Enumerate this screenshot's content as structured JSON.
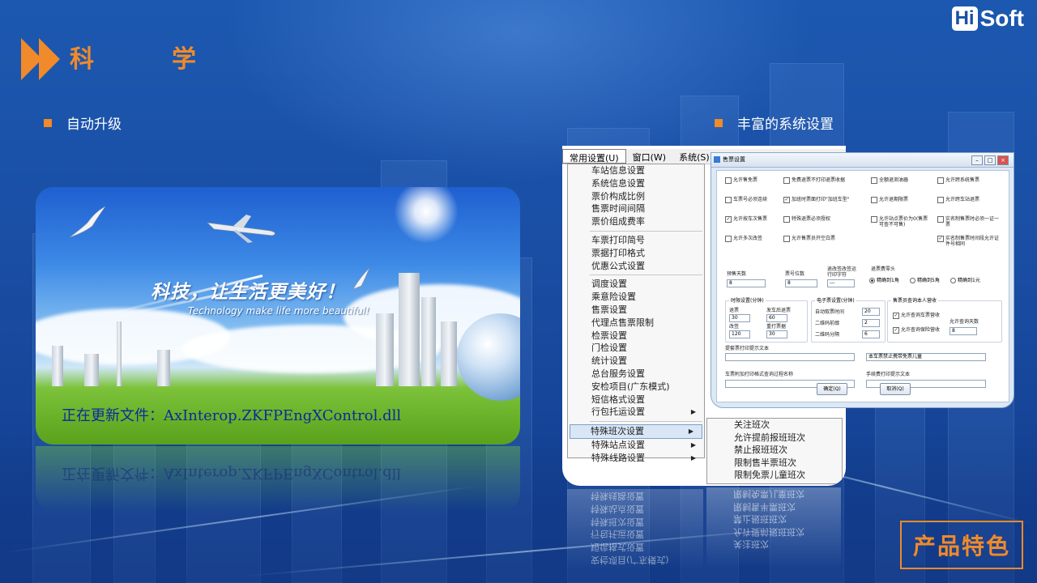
{
  "header": {
    "title_char_1": "科",
    "title_char_2": "学",
    "logo_hi": "Hi",
    "logo_soft": "Soft",
    "accent_color": "#f08a2a"
  },
  "left": {
    "bullet": "自动升级",
    "slogan": "科技，让生活更美好！",
    "slogan_en": "Technology make life more beautiful!",
    "update_status": "正在更新文件：AxInterop.ZKFPEngXControl.dll"
  },
  "right": {
    "bullet": "丰富的系统设置",
    "menubar": [
      "常用设置(U)",
      "窗口(W)",
      "系统(S)"
    ],
    "menu_groups": [
      [
        "车站信息设置",
        "系统信息设置",
        "票价构成比例",
        "售票时间间隔",
        "票价组成费率"
      ],
      [
        "车票打印简号",
        "票据打印格式",
        "优惠公式设置"
      ],
      [
        "调度设置",
        "乘意险设置",
        "售票设置",
        "代理点售票限制",
        "检票设置",
        "门检设置",
        "统计设置",
        "总台服务设置",
        "安检项目(广东模式)",
        "短信格式设置",
        "行包托运设置"
      ],
      [
        "特殊班次设置",
        "特殊站点设置",
        "特殊线路设置"
      ]
    ],
    "submenu_arrow_items": [
      "行包托运设置",
      "特殊班次设置",
      "特殊站点设置",
      "特殊线路设置"
    ],
    "selected_item": "特殊班次设置",
    "submenu": [
      "关注班次",
      "允许提前报班班次",
      "禁止报班班次",
      "限制售半票班次",
      "限制免票儿童班次"
    ],
    "dialog": {
      "title": "售票设置",
      "checkboxes": [
        {
          "label": "允许售免票",
          "checked": false
        },
        {
          "label": "免费退票不打印退票收据",
          "checked": false
        },
        {
          "label": "全额退测油器",
          "checked": false
        },
        {
          "label": "允许跨系统售票",
          "checked": false
        },
        {
          "label": "车票号必须连续",
          "checked": false
        },
        {
          "label": "加班时票面打印\"加班车型\"",
          "checked": true
        },
        {
          "label": "允许退期限票",
          "checked": false
        },
        {
          "label": "允许跨车站退票",
          "checked": false
        },
        {
          "label": "允许按车次售票",
          "checked": true
        },
        {
          "label": "特殊退票必须授权",
          "checked": false
        },
        {
          "label": "允许站点票价为0(售票可查不可售)",
          "checked": false
        },
        {
          "label": "实名制售票时必须一证一票",
          "checked": false
        },
        {
          "label": "允许多次改签",
          "checked": false
        },
        {
          "label": "允许售票员开空白票",
          "checked": false
        },
        {
          "label": "实名制售票时间段允许证件号相同",
          "checked": true
        }
      ],
      "presale_label": "预售天数",
      "presale_value": "8",
      "ticketno_label": "票号位数",
      "ticketno_value": "8",
      "code_label": "退改签改签运行印字符",
      "code_value": "---",
      "refund_group": "退票费零头",
      "refund_options": [
        "精确到1角",
        "精确到5角",
        "精确到1元"
      ],
      "refund_selected": 0,
      "time_group": "时限设置(分钟)",
      "time_fields": [
        {
          "label": "退票",
          "value": "30"
        },
        {
          "label": "发车后退票",
          "value": "60"
        },
        {
          "label": "改签",
          "value": "120"
        },
        {
          "label": "重打票据",
          "value": "30"
        }
      ],
      "eticket_group": "电子票设置(分钟)",
      "eticket_fields": [
        {
          "label": "自动取票时间",
          "value": "20"
        },
        {
          "label": "二维码前缀",
          "value": "2"
        },
        {
          "label": "二维码分隔",
          "value": "6"
        }
      ],
      "seller_group": "售票员查询本人营收",
      "seller_checks": [
        "允许查询车票营收",
        "允许查询保险营收"
      ],
      "seller_days_label": "允许查询天数",
      "seller_days_value": "8",
      "text_labels": [
        "提套票打印提示文本",
        "本车票禁止携带免票儿童",
        "车票附加打印格式查询过程名称",
        "手续费打印提示文本"
      ],
      "ok": "确定(Q)",
      "cancel": "取消(Q)"
    }
  },
  "badge": "产品特色"
}
